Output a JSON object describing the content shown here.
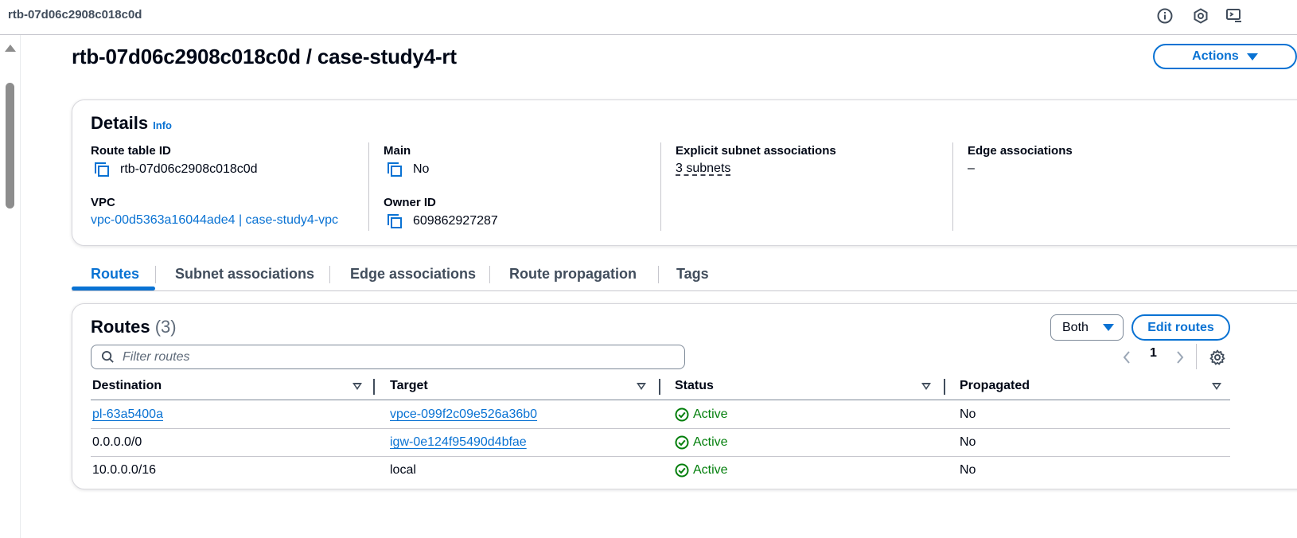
{
  "topbar": {
    "title": "rtb-07d06c2908c018c0d",
    "icons": [
      "info-icon",
      "settings-hex-icon",
      "display-icon"
    ]
  },
  "page": {
    "title": "rtb-07d06c2908c018c0d / case-study4-rt",
    "actions_label": "Actions"
  },
  "details": {
    "title": "Details",
    "info_label": "Info",
    "route_table_id_label": "Route table ID",
    "route_table_id": "rtb-07d06c2908c018c0d",
    "main_label": "Main",
    "main_value": "No",
    "explicit_label": "Explicit subnet associations",
    "explicit_value": "3 subnets",
    "edge_label": "Edge associations",
    "edge_value": "–",
    "vpc_label": "VPC",
    "vpc_value": "vpc-00d5363a16044ade4 | case-study4-vpc",
    "owner_label": "Owner ID",
    "owner_value": "609862927287"
  },
  "tabs": [
    {
      "label": "Routes",
      "active": true
    },
    {
      "label": "Subnet associations",
      "active": false
    },
    {
      "label": "Edge associations",
      "active": false
    },
    {
      "label": "Route propagation",
      "active": false
    },
    {
      "label": "Tags",
      "active": false
    }
  ],
  "routes": {
    "title": "Routes",
    "count": "(3)",
    "filter_select": "Both",
    "edit_label": "Edit routes",
    "filter_placeholder": "Filter routes",
    "page_number": "1",
    "columns": [
      "Destination",
      "Target",
      "Status",
      "Propagated"
    ],
    "rows": [
      {
        "destination": "pl-63a5400a",
        "destination_link": true,
        "target": "vpce-099f2c09e526a36b0",
        "target_link": true,
        "status": "Active",
        "propagated": "No"
      },
      {
        "destination": "0.0.0.0/0",
        "destination_link": false,
        "target": "igw-0e124f95490d4bfae",
        "target_link": true,
        "status": "Active",
        "propagated": "No"
      },
      {
        "destination": "10.0.0.0/16",
        "destination_link": false,
        "target": "local",
        "target_link": false,
        "status": "Active",
        "propagated": "No"
      }
    ]
  },
  "colors": {
    "link": "#0972d3",
    "success": "#037f0c",
    "text": "#000716"
  }
}
